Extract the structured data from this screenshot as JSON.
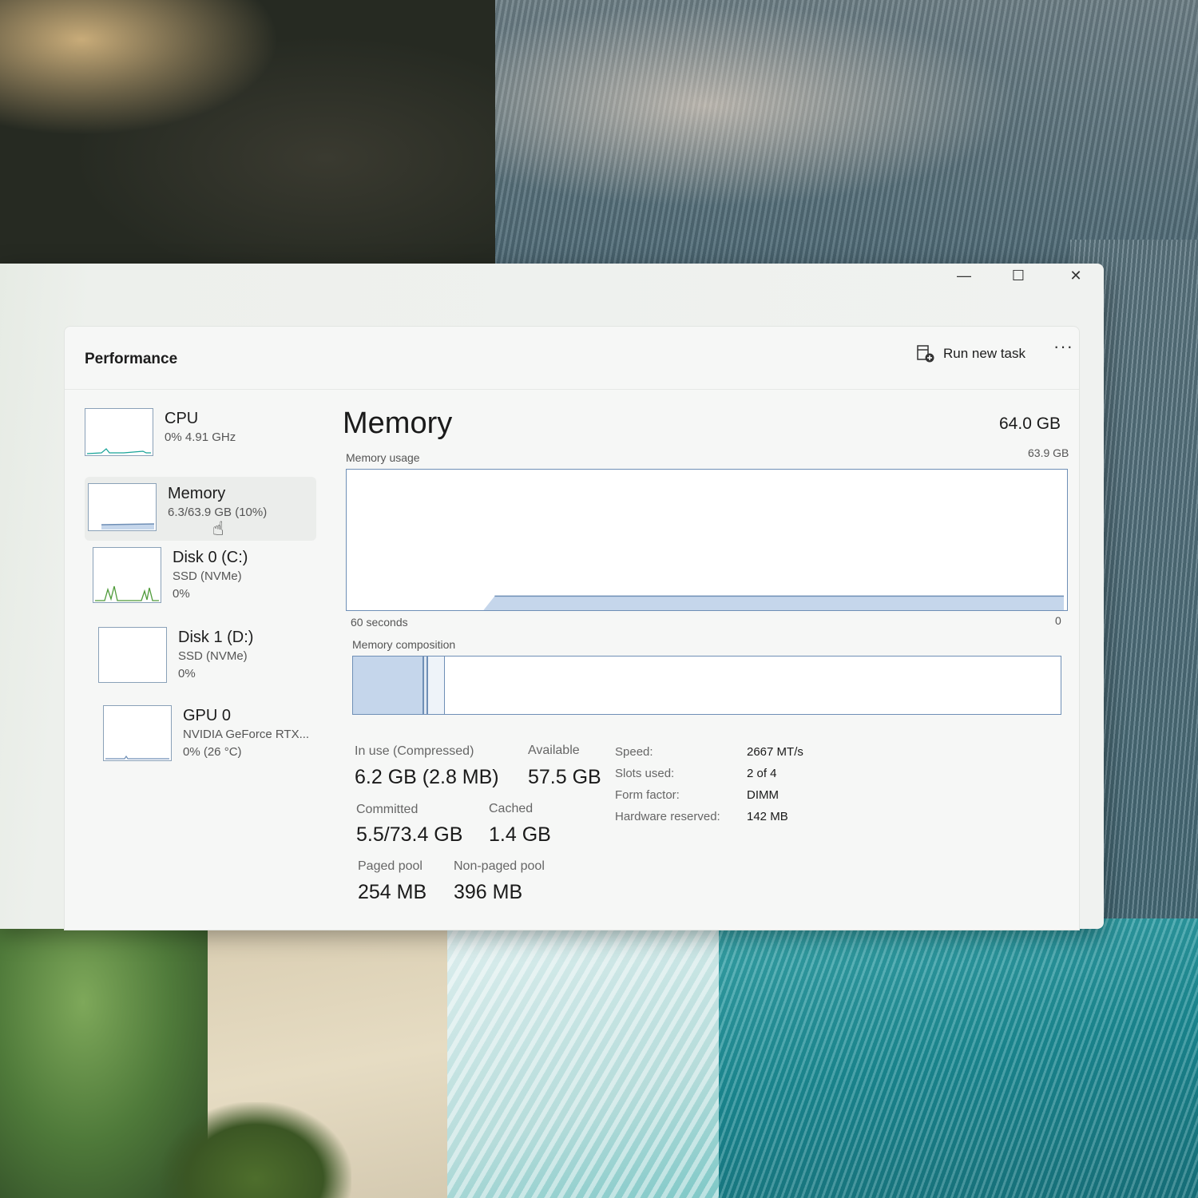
{
  "window": {
    "controls": {
      "minimize": "—",
      "maximize": "☐",
      "close": "✕"
    },
    "header": {
      "title": "Performance",
      "run_new_task": "Run new task",
      "more": "···"
    }
  },
  "sidebar": {
    "items": [
      {
        "name": "CPU",
        "sub1": "0%  4.91 GHz",
        "sub2": ""
      },
      {
        "name": "Memory",
        "sub1": "6.3/63.9 GB (10%)",
        "sub2": ""
      },
      {
        "name": "Disk 0 (C:)",
        "sub1": "SSD (NVMe)",
        "sub2": "0%"
      },
      {
        "name": "Disk 1 (D:)",
        "sub1": "SSD (NVMe)",
        "sub2": "0%"
      },
      {
        "name": "GPU 0",
        "sub1": "NVIDIA GeForce RTX...",
        "sub2": "0%  (26 °C)"
      }
    ]
  },
  "main": {
    "title": "Memory",
    "total": "64.0 GB",
    "usage_label": "Memory usage",
    "usage_max": "63.9 GB",
    "axis_left": "60 seconds",
    "axis_right": "0",
    "composition_label": "Memory composition",
    "composition": {
      "in_use_fraction": 0.098,
      "modified_fraction": 0.004,
      "standby_fraction": 0.022
    },
    "usage_fraction": 0.1,
    "stats": {
      "in_use_label": "In use (Compressed)",
      "in_use": "6.2 GB (2.8 MB)",
      "available_label": "Available",
      "available": "57.5 GB",
      "committed_label": "Committed",
      "committed": "5.5/73.4 GB",
      "cached_label": "Cached",
      "cached": "1.4 GB",
      "paged_label": "Paged pool",
      "paged": "254 MB",
      "nonpaged_label": "Non-paged pool",
      "nonpaged": "396 MB"
    },
    "details": {
      "speed_label": "Speed:",
      "speed": "2667 MT/s",
      "slots_label": "Slots used:",
      "slots": "2 of 4",
      "form_label": "Form factor:",
      "form": "DIMM",
      "reserved_label": "Hardware reserved:",
      "reserved": "142 MB"
    }
  },
  "colors": {
    "graph_line": "#6f8fb6",
    "graph_fill": "#c5d6eb"
  }
}
